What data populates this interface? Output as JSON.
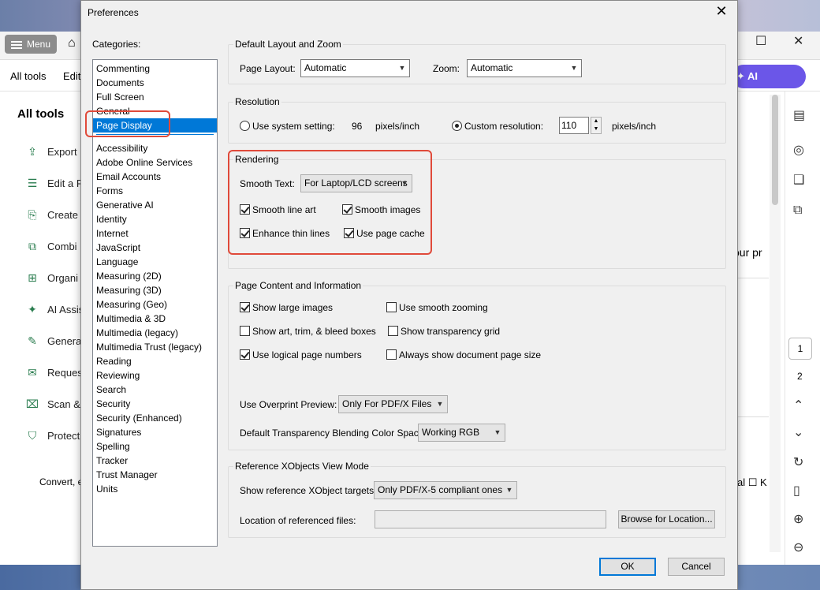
{
  "background": {
    "menu_label": "Menu",
    "tab_alltools": "All tools",
    "tab_edit": "Edit",
    "ai_assistant": "AI Assistant",
    "left_title": "All tools",
    "left_items": [
      "Export",
      "Edit a P",
      "Create",
      "Combi",
      "Organi",
      "AI Assis",
      "Genera",
      "Reques",
      "Scan &",
      "Protect"
    ],
    "left_footer": "Convert, e",
    "right_text1": "our pr",
    "right_text2": "al ☐ K",
    "page_current": "1",
    "page_next": "2"
  },
  "dialog": {
    "title": "Preferences",
    "categories_label": "Categories:",
    "categories_top": [
      "Commenting",
      "Documents",
      "Full Screen",
      "General",
      "Page Display"
    ],
    "selected_category": "Page Display",
    "categories_rest": [
      "Accessibility",
      "Adobe Online Services",
      "Email Accounts",
      "Forms",
      "Generative AI",
      "Identity",
      "Internet",
      "JavaScript",
      "Language",
      "Measuring (2D)",
      "Measuring (3D)",
      "Measuring (Geo)",
      "Multimedia & 3D",
      "Multimedia (legacy)",
      "Multimedia Trust (legacy)",
      "Reading",
      "Reviewing",
      "Search",
      "Security",
      "Security (Enhanced)",
      "Signatures",
      "Spelling",
      "Tracker",
      "Trust Manager",
      "Units"
    ],
    "layout_zoom": {
      "title": "Default Layout and Zoom",
      "page_layout_label": "Page Layout:",
      "page_layout_value": "Automatic",
      "zoom_label": "Zoom:",
      "zoom_value": "Automatic"
    },
    "resolution": {
      "title": "Resolution",
      "system_label": "Use system setting:",
      "system_value": "96",
      "system_unit": "pixels/inch",
      "custom_label": "Custom resolution:",
      "custom_value": "110",
      "custom_unit": "pixels/inch"
    },
    "rendering": {
      "title": "Rendering",
      "smooth_text_label": "Smooth Text:",
      "smooth_text_value": "For Laptop/LCD screens",
      "smooth_line_art": "Smooth line art",
      "smooth_images": "Smooth images",
      "enhance_thin_lines": "Enhance thin lines",
      "use_page_cache": "Use page cache"
    },
    "page_content": {
      "title": "Page Content and Information",
      "show_large_images": "Show large images",
      "use_smooth_zooming": "Use smooth zooming",
      "show_art_trim": "Show art, trim, & bleed boxes",
      "show_transparency_grid": "Show transparency grid",
      "use_logical_page_numbers": "Use logical page numbers",
      "always_show_page_size": "Always show document page size",
      "overprint_label": "Use Overprint Preview:",
      "overprint_value": "Only For PDF/X Files",
      "blending_label": "Default Transparency Blending Color Space:",
      "blending_value": "Working RGB"
    },
    "xobjects": {
      "title": "Reference XObjects View Mode",
      "targets_label": "Show reference XObject targets:",
      "targets_value": "Only PDF/X-5 compliant ones",
      "location_label": "Location of referenced files:",
      "location_value": "",
      "browse_label": "Browse for Location..."
    },
    "ok_label": "OK",
    "cancel_label": "Cancel"
  },
  "colors": {
    "selection": "#0078d7",
    "highlight": "#e04a3a",
    "ai_button": "#6b56e8"
  }
}
